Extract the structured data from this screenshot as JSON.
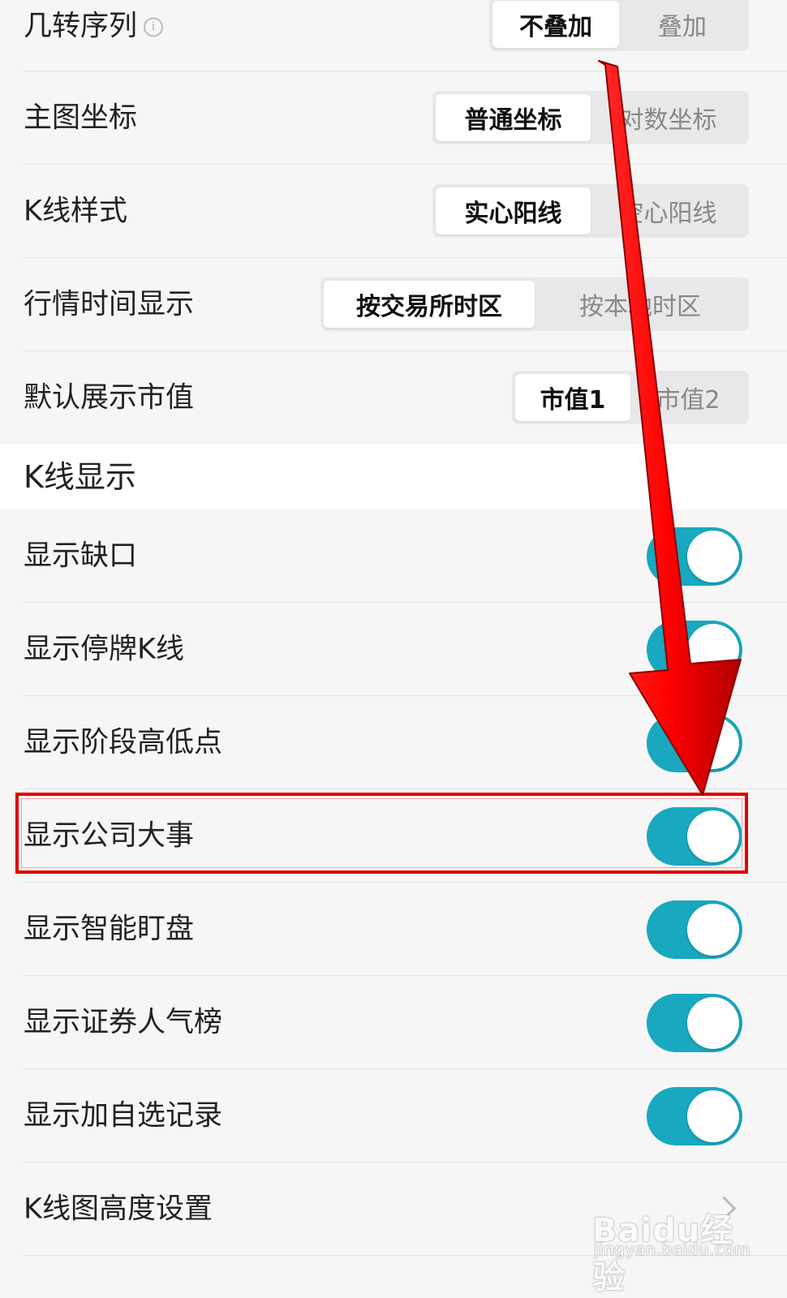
{
  "chart_settings": {
    "rows": [
      {
        "label": "几转序列",
        "options": [
          "不叠加",
          "叠加"
        ],
        "selected": "不叠加"
      },
      {
        "label": "主图坐标",
        "options": [
          "普通坐标",
          "对数坐标"
        ],
        "selected": "普通坐标"
      },
      {
        "label": "K线样式",
        "options": [
          "实心阳线",
          "空心阳线"
        ],
        "selected": "实心阳线"
      },
      {
        "label": "行情时间显示",
        "options": [
          "按交易所时区",
          "按本地时区"
        ],
        "selected": "按交易所时区"
      },
      {
        "label": "默认展示市值",
        "options": [
          "市值1",
          "市值2"
        ],
        "selected": "市值1"
      }
    ]
  },
  "kline_display": {
    "section_title": "K线显示",
    "toggles": [
      {
        "label": "显示缺口",
        "on": true
      },
      {
        "label": "显示停牌K线",
        "on": true
      },
      {
        "label": "显示阶段高低点",
        "on": true
      },
      {
        "label": "显示公司大事",
        "on": true
      },
      {
        "label": "显示智能盯盘",
        "on": true
      },
      {
        "label": "显示证券人气榜",
        "on": true
      },
      {
        "label": "显示加自选记录",
        "on": true
      }
    ],
    "height_setting_label": "K线图高度设置",
    "highlighted_item": "显示公司大事"
  },
  "colors": {
    "toggle_on": "#18a8bf",
    "annotation_red": "#e00000"
  },
  "icons": {
    "info": "info-circle-icon",
    "chevron": "chevron-right-icon"
  },
  "watermark": {
    "main": "Baidu经验",
    "sub": "jingyan.baidu.com"
  }
}
